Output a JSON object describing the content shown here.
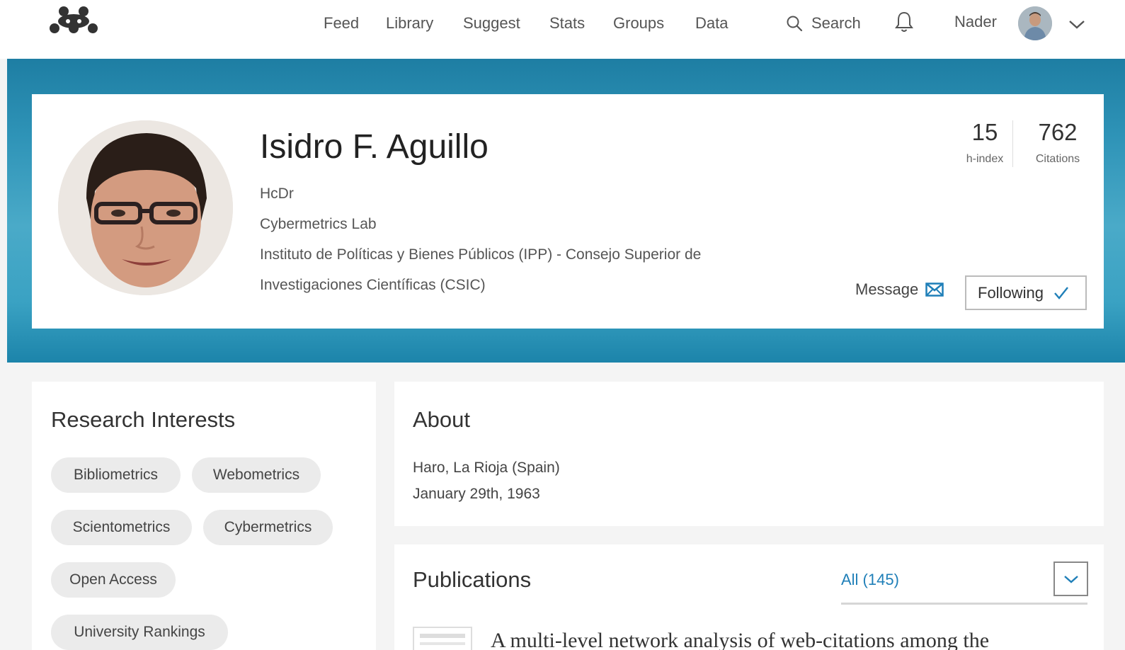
{
  "nav": {
    "items": [
      "Feed",
      "Library",
      "Suggest",
      "Stats",
      "Groups",
      "Data"
    ],
    "search_label": "Search",
    "user_name": "Nader"
  },
  "profile": {
    "name": "Isidro F. Aguillo",
    "title": "HcDr",
    "department": "Cybermetrics Lab",
    "institution_line1": "Instituto de Políticas y Bienes Públicos (IPP) - Consejo Superior de",
    "institution_line2": "Investigaciones Científicas (CSIC)",
    "h_index": "15",
    "h_index_label": "h-index",
    "citations": "762",
    "citations_label": "Citations",
    "message_label": "Message",
    "following_label": "Following"
  },
  "interests": {
    "title": "Research Interests",
    "tags": [
      "Bibliometrics",
      "Webometrics",
      "Scientometrics",
      "Cybermetrics",
      "Open Access",
      "University Rankings"
    ]
  },
  "about": {
    "title": "About",
    "location": "Haro, La Rioja (Spain)",
    "birthdate": "January 29th, 1963"
  },
  "publications": {
    "title": "Publications",
    "filter_label": "All (145)",
    "items": [
      {
        "title": "A multi-level network analysis of web-citations among the"
      }
    ]
  },
  "colors": {
    "link": "#1f7fb8",
    "banner": "#2e93b7"
  }
}
